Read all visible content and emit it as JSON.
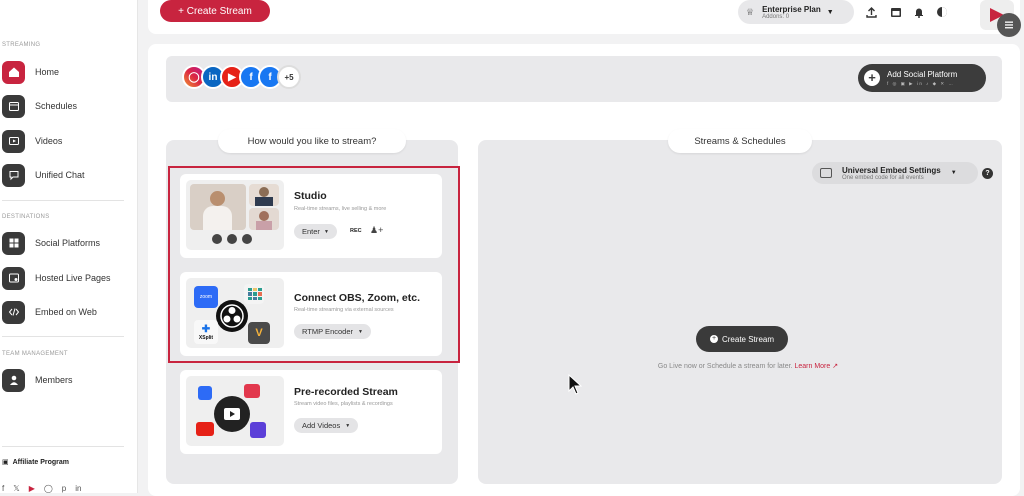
{
  "sidebar": {
    "sections": {
      "streaming": "STREAMING",
      "destinations": "DESTINATIONS",
      "team": "TEAM MANAGEMENT"
    },
    "items": [
      {
        "label": "Home",
        "icon": "home-icon",
        "active": true
      },
      {
        "label": "Schedules",
        "icon": "calendar-icon"
      },
      {
        "label": "Videos",
        "icon": "video-icon"
      },
      {
        "label": "Unified Chat",
        "icon": "chat-icon"
      },
      {
        "label": "Social Platforms",
        "icon": "grid-icon"
      },
      {
        "label": "Hosted Live Pages",
        "icon": "page-icon"
      },
      {
        "label": "Embed on Web",
        "icon": "code-icon"
      },
      {
        "label": "Members",
        "icon": "user-icon"
      }
    ],
    "affiliate": "Affiliate Program"
  },
  "header": {
    "create_stream": "+ Create Stream",
    "plan_name": "Enterprise Plan",
    "addons": "Addons: 0"
  },
  "platforms": {
    "more_count": "+5",
    "add_label": "Add Social Platform",
    "icons": [
      "instagram-icon",
      "linkedin-icon",
      "youtube-icon",
      "facebook-icon",
      "facebook-icon"
    ]
  },
  "left": {
    "question": "How would you like to stream?",
    "studio": {
      "title": "Studio",
      "subtitle": "Real-time streams, live selling & more",
      "enter": "Enter",
      "rec": "REC"
    },
    "obs": {
      "title": "Connect OBS, Zoom, etc.",
      "subtitle": "Real-time streaming via external sources",
      "encoder": "RTMP Encoder",
      "zoom": "zoom",
      "xsplit": "XSplit"
    },
    "prerecorded": {
      "title": "Pre-recorded Stream",
      "subtitle": "Stream video files, playlists & recordings",
      "add": "Add Videos"
    }
  },
  "right": {
    "title": "Streams & Schedules",
    "embed_title": "Universal Embed Settings",
    "embed_sub": "One embed code for all events",
    "help": "?",
    "create": "Create Stream",
    "golive": "Go Live now or Schedule a stream for later.",
    "learn_more": "Learn More"
  },
  "colors": {
    "accent": "#c8243f",
    "dark": "#3a3a3a"
  }
}
